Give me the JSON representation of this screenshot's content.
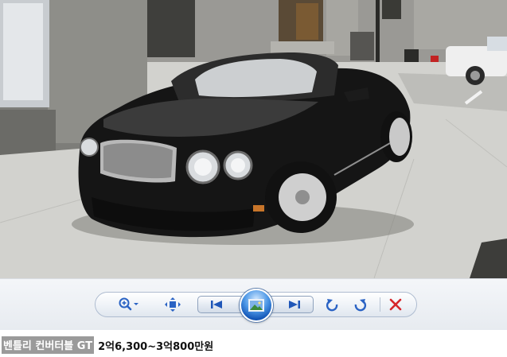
{
  "photo": {
    "subject": "black-convertible-car",
    "colors": {
      "car": "#141414",
      "pavement": "#cfcfcb",
      "building": "#8c8c87",
      "chrome": "#c9c9c9"
    }
  },
  "toolbar": {
    "buttons": [
      {
        "id": "zoom",
        "icon": "zoom-in-icon"
      },
      {
        "id": "fit",
        "icon": "fit-to-window-icon"
      },
      {
        "id": "previous",
        "icon": "previous-icon"
      },
      {
        "id": "slideshow",
        "icon": "slideshow-icon"
      },
      {
        "id": "next",
        "icon": "next-icon"
      },
      {
        "id": "rotate-ccw",
        "icon": "rotate-counterclockwise-icon"
      },
      {
        "id": "rotate-cw",
        "icon": "rotate-clockwise-icon"
      },
      {
        "id": "delete",
        "icon": "delete-icon"
      }
    ],
    "colors": {
      "icon_blue": "#2a63c4",
      "delete_red": "#d6262b",
      "border": "#aebcd0"
    }
  },
  "caption": {
    "name": "벤틀리 컨버터블 GT",
    "price": "2억6,300~3억800만원",
    "name_bg": "#9a9a9a"
  }
}
